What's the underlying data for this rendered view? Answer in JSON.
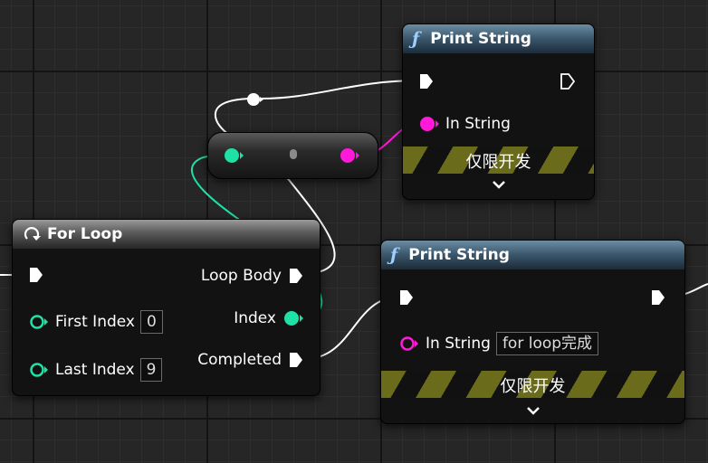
{
  "graph": {
    "background": "#262626"
  },
  "for_loop": {
    "title": "For Loop",
    "pins": {
      "loop_body": "Loop Body",
      "first_index": "First Index",
      "first_index_value": "0",
      "last_index": "Last Index",
      "last_index_value": "9",
      "index": "Index",
      "completed": "Completed"
    }
  },
  "print_string_1": {
    "title": "Print String",
    "in_string": "In String",
    "dev_only": "仅限开发"
  },
  "print_string_2": {
    "title": "Print String",
    "in_string": "In String",
    "in_string_value": "for loop完成",
    "dev_only": "仅限开发"
  },
  "colors": {
    "exec": "#ffffff",
    "integer": "#1fe0a5",
    "string": "#ff19d9",
    "dev_stripe": "#6b6b1c",
    "func_header": "#3d5a70"
  },
  "icons": {
    "function": "function-f-icon",
    "loop": "loop-icon",
    "expand": "chevron-down-icon",
    "exec_pin": "exec-arrow-icon"
  }
}
